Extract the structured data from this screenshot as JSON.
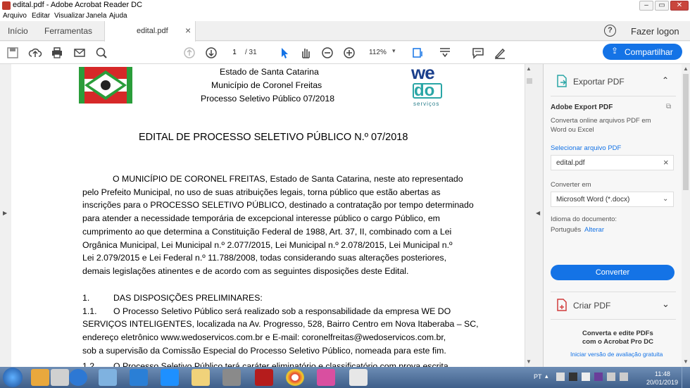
{
  "window": {
    "title": "edital.pdf - Adobe Acrobat Reader DC"
  },
  "menu": [
    "Arquivo",
    "Editar",
    "Visualizar",
    "Janela",
    "Ajuda"
  ],
  "tabs": {
    "home": "Início",
    "tools": "Ferramentas",
    "doc": "edital.pdf",
    "login": "Fazer logon",
    "help_glyph": "?",
    "close_glyph": "×"
  },
  "toolbar": {
    "page_current": "1",
    "page_total": "/ 31",
    "zoom": "112%",
    "share": "Compartilhar"
  },
  "document": {
    "header_lines": [
      "Estado de Santa Catarina",
      "Município de Coronel Freitas",
      "Processo Seletivo Público 07/2018"
    ],
    "logo_top": "we",
    "logo_mid": "do",
    "logo_sub": "serviços",
    "title": "EDITAL DE PROCESSO SELETIVO PÚBLICO N.º 07/2018",
    "para1_bold": "MUNICÍPIO DE CORONEL FREITAS,",
    "para1": [
      "O",
      "Estado de Santa Catarina, neste ato representado",
      "pelo Prefeito Municipal, no uso de suas atribuições legais, torna público que estão abertas as",
      "inscrições para o PROCESSO SELETIVO PÚBLICO, destinado a contratação por tempo determinado",
      "para atender a necessidade temporária de excepcional interesse público o cargo Público, em",
      "cumprimento ao que determina a Constituição Federal de 1988, Art. 37, II, combinado com a Lei",
      "Orgânica Municipal, Lei Municipal n.º 2.077/2015, Lei Municipal n.º 2.078/2015, Lei Municipal n.º",
      "Lei 2.079/2015 e Lei Federal n.º 11.788/2008, todas considerando suas alterações posteriores,",
      "demais legislações atinentes e de acordo com as seguintes disposições deste Edital."
    ],
    "sec1_num": "1.",
    "sec1_title": "DAS DISPOSIÇÕES PRELIMINARES:",
    "sub11_num": "1.1.",
    "sub11_lines": [
      "O Processo Seletivo Público será realizado sob a responsabilidade da empresa",
      "WE DO",
      "SERVIÇOS INTELIGENTES",
      ", localizada na Av. Progresso, 528, Bairro Centro em Nova Itaberaba – SC,",
      "endereço eletrônico www.wedoservicos.com.br e E-mail: coronelfreitas@wedoservicos.com.br,",
      "sob a supervisão da Comissão Especial do Processo Seletivo Público, nomeada para este fim."
    ],
    "sub12_num": "1.2.",
    "sub12_text": "O Processo Seletivo Público terá caráter eliminatório e classificatório com prova escrita"
  },
  "panel": {
    "export_header": "Exportar PDF",
    "export_title": "Adobe Export PDF",
    "export_desc": [
      "Converta online arquivos PDF em",
      "Word ou Excel"
    ],
    "select_file": "Selecionar arquivo PDF",
    "file_name": "edital.pdf",
    "convert_to_label": "Converter em",
    "convert_to_value": "Microsoft Word (*.docx)",
    "lang_label": "Idioma do documento:",
    "lang_value": "Português",
    "lang_change": "Alterar",
    "convert_button": "Converter",
    "create_pdf": "Criar PDF",
    "promo_lines": [
      "Converta e edite PDFs",
      "com o Acrobat Pro DC"
    ],
    "trial_link": "Iniciar versão de avaliação gratuita"
  },
  "taskbar": {
    "lang": "PT",
    "time": "11:48",
    "date": "20/01/2019"
  },
  "colors": {
    "accent": "#1473e6",
    "taskbar": "#4a6b96"
  }
}
